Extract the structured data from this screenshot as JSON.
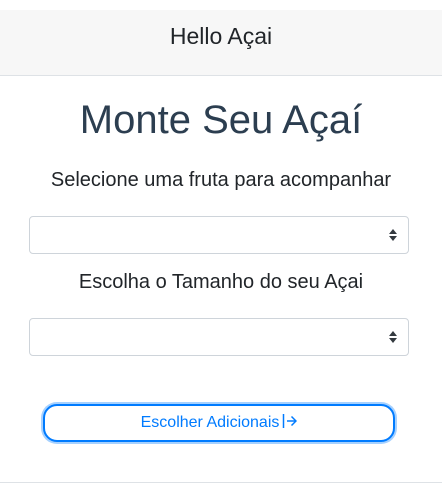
{
  "header": {
    "title": "Hello Açai"
  },
  "main": {
    "title": "Monte Seu Açaí",
    "fruit_label": "Selecione uma fruta para acompanhar",
    "fruit_select_value": "",
    "size_label": "Escolha o Tamanho do seu Açai",
    "size_select_value": "",
    "submit_label": "Escolher Adicionais"
  },
  "colors": {
    "accent": "#007bff",
    "title_text": "#2c3e50",
    "header_bg": "#f7f7f7"
  },
  "icons": {
    "select_caret": "sort-caret-icon",
    "submit_arrow": "arrow-right-to-bar-icon"
  }
}
